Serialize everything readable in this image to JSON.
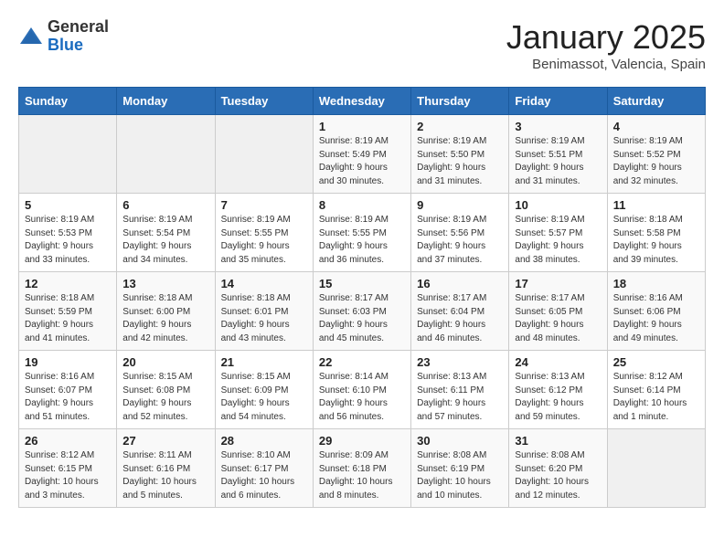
{
  "logo": {
    "general": "General",
    "blue": "Blue"
  },
  "header": {
    "month": "January 2025",
    "location": "Benimassot, Valencia, Spain"
  },
  "weekdays": [
    "Sunday",
    "Monday",
    "Tuesday",
    "Wednesday",
    "Thursday",
    "Friday",
    "Saturday"
  ],
  "weeks": [
    [
      {
        "day": "",
        "info": ""
      },
      {
        "day": "",
        "info": ""
      },
      {
        "day": "",
        "info": ""
      },
      {
        "day": "1",
        "info": "Sunrise: 8:19 AM\nSunset: 5:49 PM\nDaylight: 9 hours\nand 30 minutes."
      },
      {
        "day": "2",
        "info": "Sunrise: 8:19 AM\nSunset: 5:50 PM\nDaylight: 9 hours\nand 31 minutes."
      },
      {
        "day": "3",
        "info": "Sunrise: 8:19 AM\nSunset: 5:51 PM\nDaylight: 9 hours\nand 31 minutes."
      },
      {
        "day": "4",
        "info": "Sunrise: 8:19 AM\nSunset: 5:52 PM\nDaylight: 9 hours\nand 32 minutes."
      }
    ],
    [
      {
        "day": "5",
        "info": "Sunrise: 8:19 AM\nSunset: 5:53 PM\nDaylight: 9 hours\nand 33 minutes."
      },
      {
        "day": "6",
        "info": "Sunrise: 8:19 AM\nSunset: 5:54 PM\nDaylight: 9 hours\nand 34 minutes."
      },
      {
        "day": "7",
        "info": "Sunrise: 8:19 AM\nSunset: 5:55 PM\nDaylight: 9 hours\nand 35 minutes."
      },
      {
        "day": "8",
        "info": "Sunrise: 8:19 AM\nSunset: 5:55 PM\nDaylight: 9 hours\nand 36 minutes."
      },
      {
        "day": "9",
        "info": "Sunrise: 8:19 AM\nSunset: 5:56 PM\nDaylight: 9 hours\nand 37 minutes."
      },
      {
        "day": "10",
        "info": "Sunrise: 8:19 AM\nSunset: 5:57 PM\nDaylight: 9 hours\nand 38 minutes."
      },
      {
        "day": "11",
        "info": "Sunrise: 8:18 AM\nSunset: 5:58 PM\nDaylight: 9 hours\nand 39 minutes."
      }
    ],
    [
      {
        "day": "12",
        "info": "Sunrise: 8:18 AM\nSunset: 5:59 PM\nDaylight: 9 hours\nand 41 minutes."
      },
      {
        "day": "13",
        "info": "Sunrise: 8:18 AM\nSunset: 6:00 PM\nDaylight: 9 hours\nand 42 minutes."
      },
      {
        "day": "14",
        "info": "Sunrise: 8:18 AM\nSunset: 6:01 PM\nDaylight: 9 hours\nand 43 minutes."
      },
      {
        "day": "15",
        "info": "Sunrise: 8:17 AM\nSunset: 6:03 PM\nDaylight: 9 hours\nand 45 minutes."
      },
      {
        "day": "16",
        "info": "Sunrise: 8:17 AM\nSunset: 6:04 PM\nDaylight: 9 hours\nand 46 minutes."
      },
      {
        "day": "17",
        "info": "Sunrise: 8:17 AM\nSunset: 6:05 PM\nDaylight: 9 hours\nand 48 minutes."
      },
      {
        "day": "18",
        "info": "Sunrise: 8:16 AM\nSunset: 6:06 PM\nDaylight: 9 hours\nand 49 minutes."
      }
    ],
    [
      {
        "day": "19",
        "info": "Sunrise: 8:16 AM\nSunset: 6:07 PM\nDaylight: 9 hours\nand 51 minutes."
      },
      {
        "day": "20",
        "info": "Sunrise: 8:15 AM\nSunset: 6:08 PM\nDaylight: 9 hours\nand 52 minutes."
      },
      {
        "day": "21",
        "info": "Sunrise: 8:15 AM\nSunset: 6:09 PM\nDaylight: 9 hours\nand 54 minutes."
      },
      {
        "day": "22",
        "info": "Sunrise: 8:14 AM\nSunset: 6:10 PM\nDaylight: 9 hours\nand 56 minutes."
      },
      {
        "day": "23",
        "info": "Sunrise: 8:13 AM\nSunset: 6:11 PM\nDaylight: 9 hours\nand 57 minutes."
      },
      {
        "day": "24",
        "info": "Sunrise: 8:13 AM\nSunset: 6:12 PM\nDaylight: 9 hours\nand 59 minutes."
      },
      {
        "day": "25",
        "info": "Sunrise: 8:12 AM\nSunset: 6:14 PM\nDaylight: 10 hours\nand 1 minute."
      }
    ],
    [
      {
        "day": "26",
        "info": "Sunrise: 8:12 AM\nSunset: 6:15 PM\nDaylight: 10 hours\nand 3 minutes."
      },
      {
        "day": "27",
        "info": "Sunrise: 8:11 AM\nSunset: 6:16 PM\nDaylight: 10 hours\nand 5 minutes."
      },
      {
        "day": "28",
        "info": "Sunrise: 8:10 AM\nSunset: 6:17 PM\nDaylight: 10 hours\nand 6 minutes."
      },
      {
        "day": "29",
        "info": "Sunrise: 8:09 AM\nSunset: 6:18 PM\nDaylight: 10 hours\nand 8 minutes."
      },
      {
        "day": "30",
        "info": "Sunrise: 8:08 AM\nSunset: 6:19 PM\nDaylight: 10 hours\nand 10 minutes."
      },
      {
        "day": "31",
        "info": "Sunrise: 8:08 AM\nSunset: 6:20 PM\nDaylight: 10 hours\nand 12 minutes."
      },
      {
        "day": "",
        "info": ""
      }
    ]
  ]
}
